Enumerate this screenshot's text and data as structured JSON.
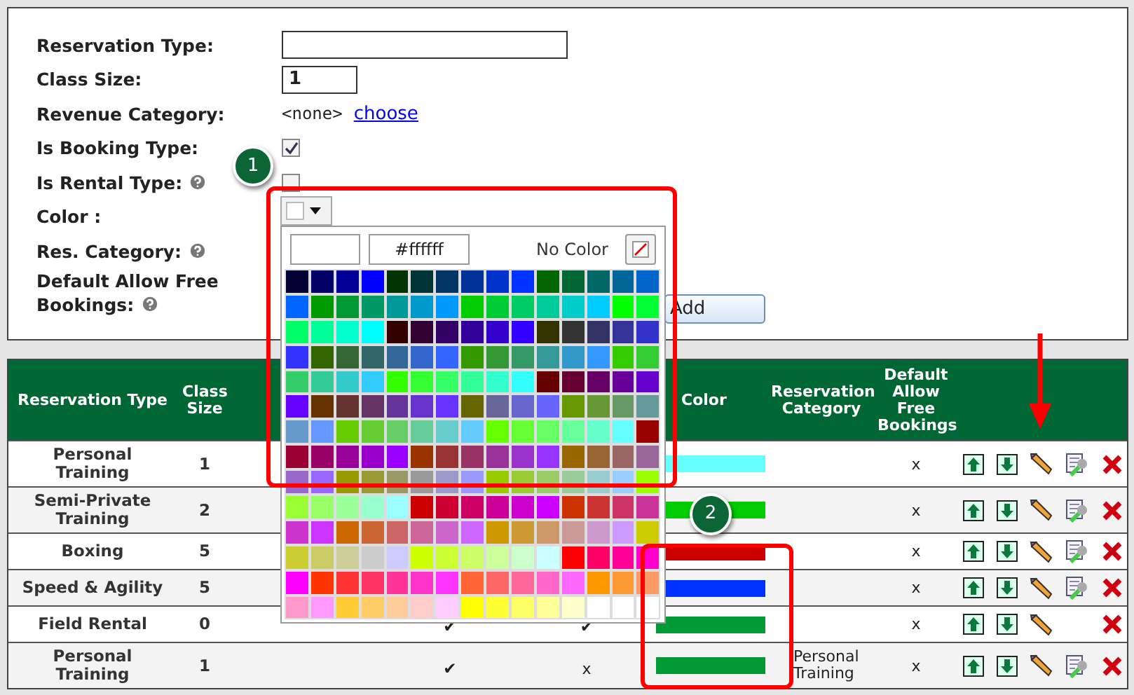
{
  "form": {
    "fields": [
      {
        "kind": "text",
        "label": "Reservation Type:"
      },
      {
        "kind": "number",
        "label": "Class Size:",
        "value": "1"
      },
      {
        "kind": "link",
        "label": "Revenue Category:",
        "text": "<none>",
        "link": "choose"
      },
      {
        "kind": "checkbox",
        "label": "Is Booking Type:",
        "checked": true
      },
      {
        "kind": "checkbox",
        "label": "Is Rental Type:",
        "help": true,
        "checked": false
      },
      {
        "kind": "color",
        "label": "Color :"
      },
      {
        "kind": "plain",
        "label": "Res. Category:",
        "help": true
      },
      {
        "kind": "plain",
        "label": "Default Allow Free Bookings:",
        "help": true
      }
    ],
    "add_button": "Add"
  },
  "color_picker": {
    "hex": "#ffffff",
    "no_color": "No Color",
    "swatches": [
      {
        "color": "#000033"
      },
      {
        "color": "#000066"
      },
      {
        "color": "#000099"
      },
      {
        "color": "#0000ff"
      },
      {
        "color": "#003300"
      },
      {
        "color": "#003333"
      },
      {
        "color": "#003366"
      },
      {
        "color": "#003399"
      },
      {
        "color": "#0033cc"
      },
      {
        "color": "#0033ff"
      },
      {
        "color": "#006600"
      },
      {
        "color": "#006633"
      },
      {
        "color": "#006666"
      },
      {
        "color": "#006699"
      },
      {
        "color": "#0066cc"
      },
      {
        "color": "#0066ff"
      },
      {
        "color": "#009900"
      },
      {
        "color": "#009933"
      },
      {
        "color": "#009966"
      },
      {
        "color": "#009999"
      },
      {
        "color": "#0099cc"
      },
      {
        "color": "#0099ff"
      },
      {
        "color": "#00cc00"
      },
      {
        "color": "#00cc33"
      },
      {
        "color": "#00cc66"
      },
      {
        "color": "#00cc99"
      },
      {
        "color": "#00cccc"
      },
      {
        "color": "#00ccff"
      },
      {
        "color": "#00ff00"
      },
      {
        "color": "#00ff33"
      },
      {
        "color": "#00ff66"
      },
      {
        "color": "#00ff99"
      },
      {
        "color": "#00ffcc"
      },
      {
        "color": "#00ffff"
      },
      {
        "color": "#330000"
      },
      {
        "color": "#330033"
      },
      {
        "color": "#330066"
      },
      {
        "color": "#330099"
      },
      {
        "color": "#3300cc"
      },
      {
        "color": "#3300ff"
      },
      {
        "color": "#333300"
      },
      {
        "color": "#333333"
      },
      {
        "color": "#333366"
      },
      {
        "color": "#333399"
      },
      {
        "color": "#3333cc"
      },
      {
        "color": "#3333ff"
      },
      {
        "color": "#336600"
      },
      {
        "color": "#336633"
      },
      {
        "color": "#336666"
      },
      {
        "color": "#336699"
      },
      {
        "color": "#3366cc"
      },
      {
        "color": "#3366ff"
      },
      {
        "color": "#339900"
      },
      {
        "color": "#339933"
      },
      {
        "color": "#339966"
      },
      {
        "color": "#339999"
      },
      {
        "color": "#3399cc"
      },
      {
        "color": "#3399ff"
      },
      {
        "color": "#33cc00"
      },
      {
        "color": "#33cc33"
      },
      {
        "color": "#33cc66"
      },
      {
        "color": "#33cc99"
      },
      {
        "color": "#33cccc"
      },
      {
        "color": "#33ccff"
      },
      {
        "color": "#33ff00"
      },
      {
        "color": "#33ff33"
      },
      {
        "color": "#33ff66"
      },
      {
        "color": "#33ff99"
      },
      {
        "color": "#33ffcc"
      },
      {
        "color": "#33ffff"
      },
      {
        "color": "#660000"
      },
      {
        "color": "#660033"
      },
      {
        "color": "#660066"
      },
      {
        "color": "#660099"
      },
      {
        "color": "#6600cc"
      },
      {
        "color": "#6600ff"
      },
      {
        "color": "#663300"
      },
      {
        "color": "#663333"
      },
      {
        "color": "#663366"
      },
      {
        "color": "#663399"
      },
      {
        "color": "#6633cc"
      },
      {
        "color": "#6633ff"
      },
      {
        "color": "#666600"
      },
      {
        "color": "#666699"
      },
      {
        "color": "#6666cc"
      },
      {
        "color": "#6666ff"
      },
      {
        "color": "#669900"
      },
      {
        "color": "#669933"
      },
      {
        "color": "#669966"
      },
      {
        "color": "#669999"
      },
      {
        "color": "#6699cc"
      },
      {
        "color": "#6699ff"
      },
      {
        "color": "#66cc00"
      },
      {
        "color": "#66cc33"
      },
      {
        "color": "#66cc66"
      },
      {
        "color": "#66cc99"
      },
      {
        "color": "#66cccc"
      },
      {
        "color": "#66ccff"
      },
      {
        "color": "#66ff00"
      },
      {
        "color": "#66ff33"
      },
      {
        "color": "#66ff66"
      },
      {
        "color": "#66ff99"
      },
      {
        "color": "#66ffcc"
      },
      {
        "color": "#66ffff"
      },
      {
        "color": "#990000"
      },
      {
        "color": "#990033"
      },
      {
        "color": "#990066"
      },
      {
        "color": "#990099"
      },
      {
        "color": "#9900cc"
      },
      {
        "color": "#9900ff"
      },
      {
        "color": "#993300"
      },
      {
        "color": "#993333"
      },
      {
        "color": "#993366"
      },
      {
        "color": "#993399"
      },
      {
        "color": "#9933cc"
      },
      {
        "color": "#9933ff"
      },
      {
        "color": "#996600"
      },
      {
        "color": "#996633"
      },
      {
        "color": "#996666"
      },
      {
        "color": "#996699"
      },
      {
        "color": "#9966cc"
      },
      {
        "color": "#9966ff"
      },
      {
        "color": "#999900"
      },
      {
        "color": "#999933"
      },
      {
        "color": "#999966"
      },
      {
        "color": "#999999"
      },
      {
        "color": "#9999cc"
      },
      {
        "color": "#9999ff"
      },
      {
        "color": "#99cc00"
      },
      {
        "color": "#99cc33"
      },
      {
        "color": "#99cc66"
      },
      {
        "color": "#99cc99"
      },
      {
        "color": "#99cccc"
      },
      {
        "color": "#99ccff"
      },
      {
        "color": "#99ff00"
      },
      {
        "color": "#99ff33"
      },
      {
        "color": "#99ff66"
      },
      {
        "color": "#99ff99"
      },
      {
        "color": "#99ffcc"
      },
      {
        "color": "#99ffff"
      },
      {
        "color": "#cc0000"
      },
      {
        "color": "#cc0033"
      },
      {
        "color": "#cc0066"
      },
      {
        "color": "#cc0099"
      },
      {
        "color": "#cc00cc"
      },
      {
        "color": "#cc00ff"
      },
      {
        "color": "#cc3300"
      },
      {
        "color": "#cc3333"
      },
      {
        "color": "#cc3366"
      },
      {
        "color": "#cc3399"
      },
      {
        "color": "#cc33cc"
      },
      {
        "color": "#cc33ff"
      },
      {
        "color": "#cc6600"
      },
      {
        "color": "#cc6633"
      },
      {
        "color": "#cc6666"
      },
      {
        "color": "#cc6699"
      },
      {
        "color": "#cc66cc"
      },
      {
        "color": "#cc66ff"
      },
      {
        "color": "#cc9900"
      },
      {
        "color": "#cc9933"
      },
      {
        "color": "#cc9966"
      },
      {
        "color": "#cc9999"
      },
      {
        "color": "#cc99cc"
      },
      {
        "color": "#cc99ff"
      },
      {
        "color": "#cccc00"
      },
      {
        "color": "#cccc33"
      },
      {
        "color": "#cccc66"
      },
      {
        "color": "#cccc99"
      },
      {
        "color": "#cccccc"
      },
      {
        "color": "#ccccff"
      },
      {
        "color": "#ccff00"
      },
      {
        "color": "#ccff33"
      },
      {
        "color": "#ccff66"
      },
      {
        "color": "#ccff99"
      },
      {
        "color": "#ccffcc"
      },
      {
        "color": "#ccffff"
      },
      {
        "color": "#ff0000"
      },
      {
        "color": "#ff0066"
      },
      {
        "color": "#ff0099"
      },
      {
        "color": "#ff00cc"
      },
      {
        "color": "#ff00ff"
      },
      {
        "color": "#ff3300"
      },
      {
        "color": "#ff3333"
      },
      {
        "color": "#ff3366"
      },
      {
        "color": "#ff3399"
      },
      {
        "color": "#ff33cc"
      },
      {
        "color": "#ff33ff"
      },
      {
        "color": "#ff6633"
      },
      {
        "color": "#ff6666"
      },
      {
        "color": "#ff6699"
      },
      {
        "color": "#ff66cc"
      },
      {
        "color": "#ff66ff"
      },
      {
        "color": "#ff9900"
      },
      {
        "color": "#ff9933"
      },
      {
        "color": "#ff9966"
      },
      {
        "color": "#ff99cc"
      },
      {
        "color": "#ff99ff"
      },
      {
        "color": "#ffcc33"
      },
      {
        "color": "#ffcc66"
      },
      {
        "color": "#ffcc99"
      },
      {
        "color": "#ffcccc"
      },
      {
        "color": "#ffccff"
      },
      {
        "color": "#ffff00"
      },
      {
        "color": "#ffff33"
      },
      {
        "color": "#ffff66"
      },
      {
        "color": "#ffff99"
      },
      {
        "color": "#ffffcc"
      },
      {
        "color": "#ffffff"
      },
      {
        "color": "#ffffff"
      },
      {
        "color": "#ffffff"
      }
    ]
  },
  "table": {
    "columns": [
      "Reservation Type",
      "Class Size",
      "Color",
      "Reservation Category",
      "Default Allow Free Bookings"
    ],
    "rows": [
      {
        "type": "Personal Training",
        "size": "1",
        "color": "#66ffff",
        "free": "x",
        "settings": true
      },
      {
        "type": "Semi-Private Training",
        "size": "2",
        "color": "#00cc00",
        "free": "x",
        "settings": true
      },
      {
        "type": "Boxing",
        "size": "5",
        "color": "#cc0000",
        "free": "x",
        "settings": true
      },
      {
        "type": "Speed & Agility",
        "size": "5",
        "color": "#0033ff",
        "free": "x",
        "settings": true
      },
      {
        "type": "Field Rental",
        "size": "0",
        "column_3": "✔",
        "column_4": "✔",
        "color": "#009933",
        "free": "x",
        "settings": false
      },
      {
        "type": "Personal Training",
        "size": "1",
        "column_3": "✔",
        "column_4": "x",
        "color": "#009933",
        "category": "Personal Training",
        "free": "x",
        "settings": true
      }
    ]
  },
  "callouts": [
    "1",
    "2"
  ]
}
